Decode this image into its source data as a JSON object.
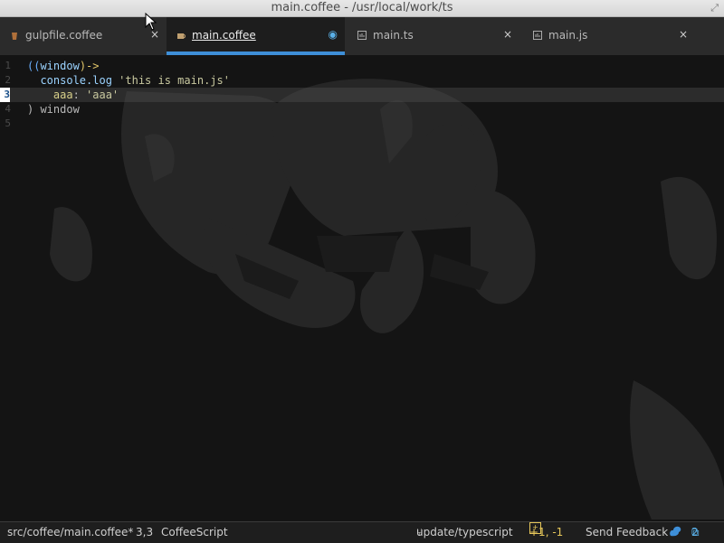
{
  "window": {
    "title": "main.coffee - /usr/local/work/ts",
    "expand_icon": "fullscreen-icon"
  },
  "tabs": [
    {
      "label": "gulpfile.coffee",
      "icon": "coffee-file-icon",
      "close": "×",
      "active": false
    },
    {
      "label": "main.coffee",
      "icon": "coffee-file-icon",
      "close": "◉",
      "active": true
    },
    {
      "label": "main.ts",
      "icon": "file-icon",
      "close": "×",
      "active": false
    },
    {
      "label": "main.js",
      "icon": "file-icon",
      "close": "×",
      "active": false
    }
  ],
  "editor": {
    "lines": [
      {
        "num": "1",
        "tokens": [
          {
            "t": "((",
            "c": "kw"
          },
          {
            "t": "window",
            "c": "fn"
          },
          {
            "t": ")->",
            "c": "arrow"
          }
        ]
      },
      {
        "num": "2",
        "tokens": [
          {
            "t": "  console.log ",
            "c": "fn"
          },
          {
            "t": "'this is main.js'",
            "c": "str"
          }
        ]
      },
      {
        "num": "3",
        "tokens": [
          {
            "t": "    aaa",
            "c": "key"
          },
          {
            "t": ": ",
            "c": "plain"
          },
          {
            "t": "'aaa'",
            "c": "str"
          }
        ],
        "current": true
      },
      {
        "num": "4",
        "tokens": [
          {
            "t": ") window",
            "c": "plain"
          }
        ]
      },
      {
        "num": "5",
        "tokens": []
      }
    ]
  },
  "status": {
    "file_path": "src/coffee/main.coffee*",
    "cursor_pos": "3,3",
    "grammar": "CoffeeScript",
    "branch": "update/typescript",
    "diff": "+1, -1",
    "feedback": "Send Feedback",
    "package_count": "2"
  },
  "colors": {
    "accent": "#3e8fd8",
    "background": "#141414",
    "tabbar": "#2b2b2b"
  }
}
